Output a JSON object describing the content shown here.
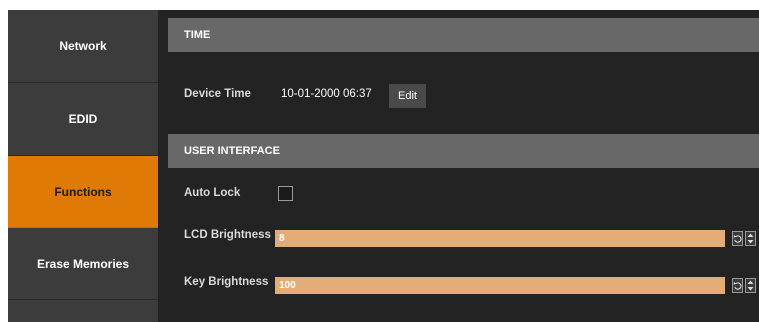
{
  "sidebar": {
    "items": [
      {
        "label": "Network",
        "active": false
      },
      {
        "label": "EDID",
        "active": false
      },
      {
        "label": "Functions",
        "active": true
      },
      {
        "label": "Erase Memories",
        "active": false
      }
    ]
  },
  "time_section": {
    "title": "TIME",
    "device_time_label": "Device Time",
    "device_time_value": "10-01-2000 06:37",
    "edit_label": "Edit"
  },
  "ui_section": {
    "title": "USER INTERFACE",
    "auto_lock_label": "Auto Lock",
    "auto_lock_checked": false,
    "lcd_brightness_label": "LCD Brightness",
    "lcd_brightness_value": "8",
    "key_brightness_label": "Key Brightness",
    "key_brightness_value": "100"
  },
  "colors": {
    "active_tab": "#e07a07",
    "input_fill": "#e4ad77",
    "section_header": "#686868",
    "background": "#232323"
  },
  "icons": {
    "reset": "undo-icon",
    "stepper": "up-down-arrows-icon"
  }
}
